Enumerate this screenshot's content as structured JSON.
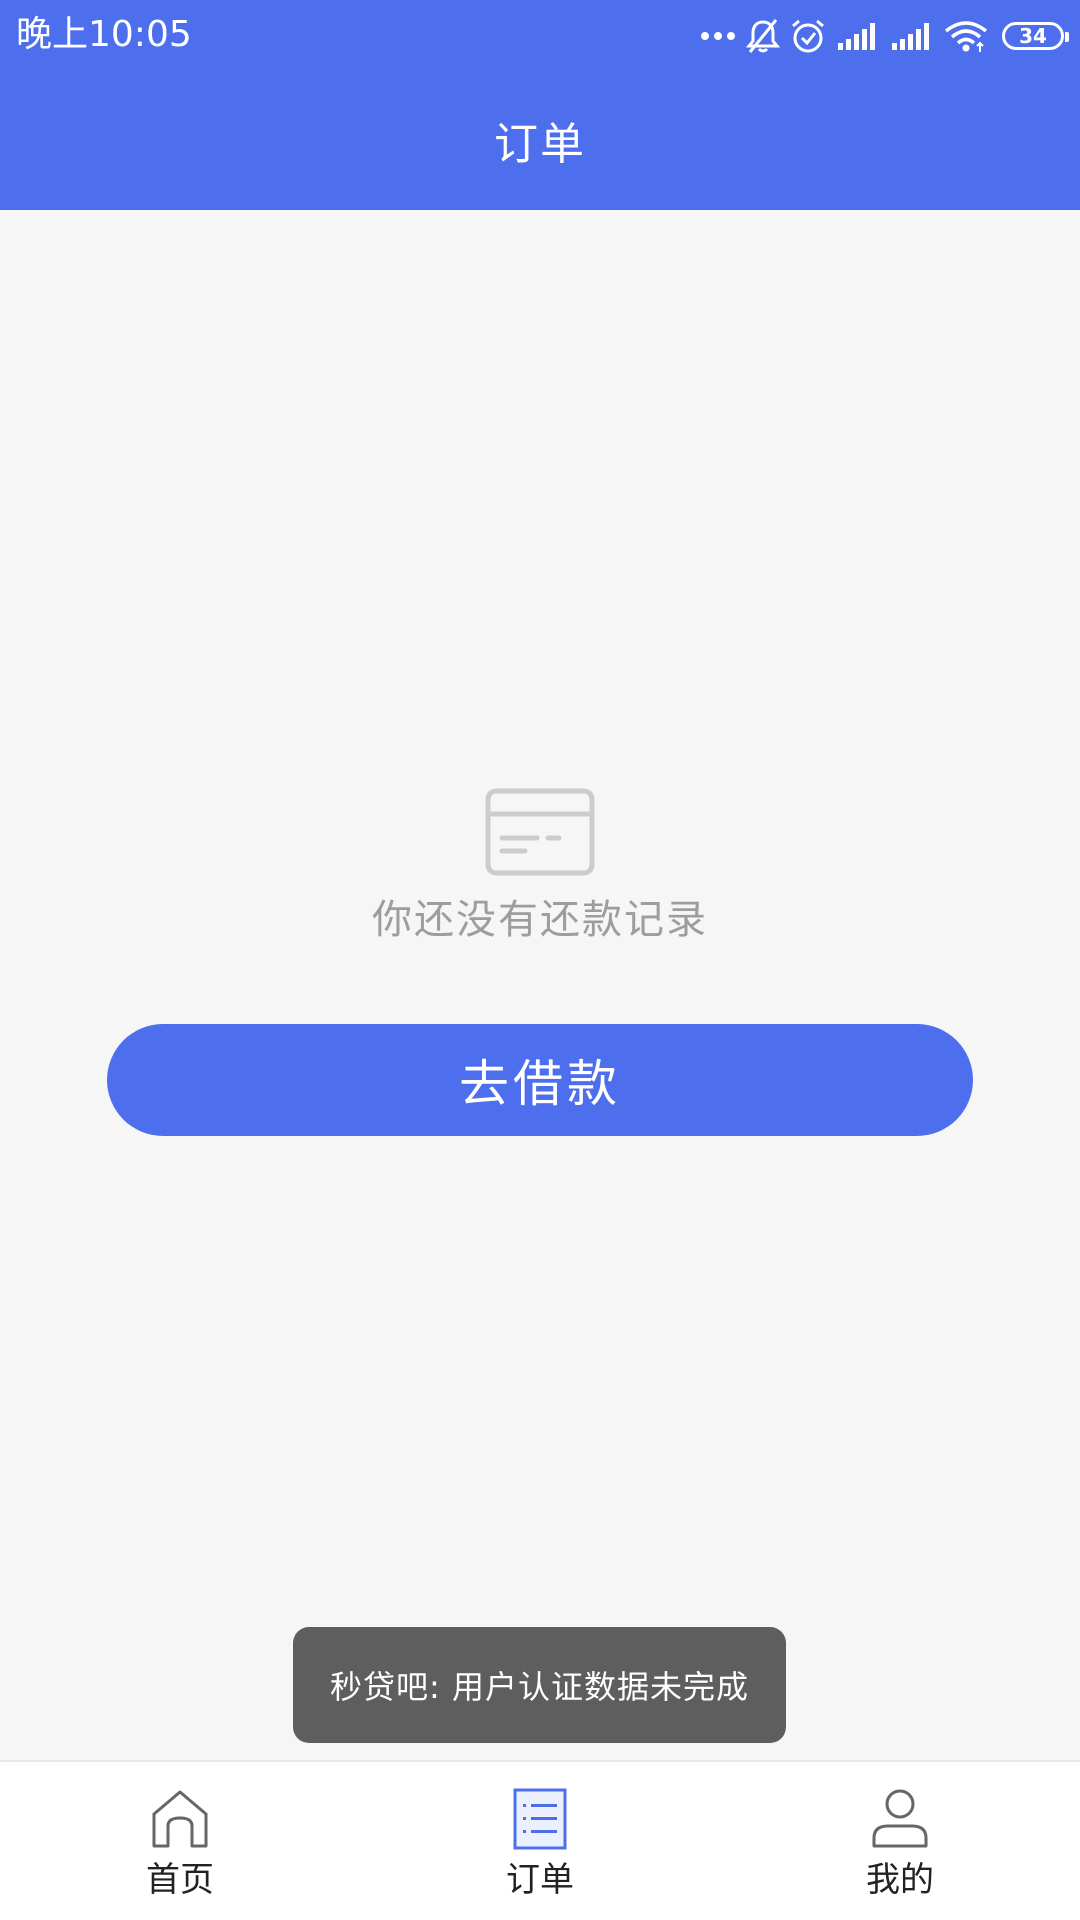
{
  "status_bar": {
    "time": "晚上10:05",
    "battery": "34",
    "icons": [
      "more-dots-icon",
      "mute-bell-icon",
      "alarm-icon",
      "signal-icon",
      "signal-icon",
      "wifi-icon",
      "battery-icon"
    ]
  },
  "header": {
    "title": "订单"
  },
  "empty_state": {
    "icon": "card-icon",
    "message": "你还没有还款记录",
    "button_label": "去借款"
  },
  "toast": {
    "message": "秒贷吧: 用户认证数据未完成"
  },
  "bottom_nav": {
    "items": [
      {
        "label": "首页",
        "icon": "home-icon",
        "active": false
      },
      {
        "label": "订单",
        "icon": "order-list-icon",
        "active": true
      },
      {
        "label": "我的",
        "icon": "user-icon",
        "active": false
      }
    ]
  },
  "colors": {
    "primary": "#4d6fee",
    "background": "#f6f6f6",
    "muted_text": "#9d9d9d",
    "toast_bg": "#5e5e5e"
  }
}
